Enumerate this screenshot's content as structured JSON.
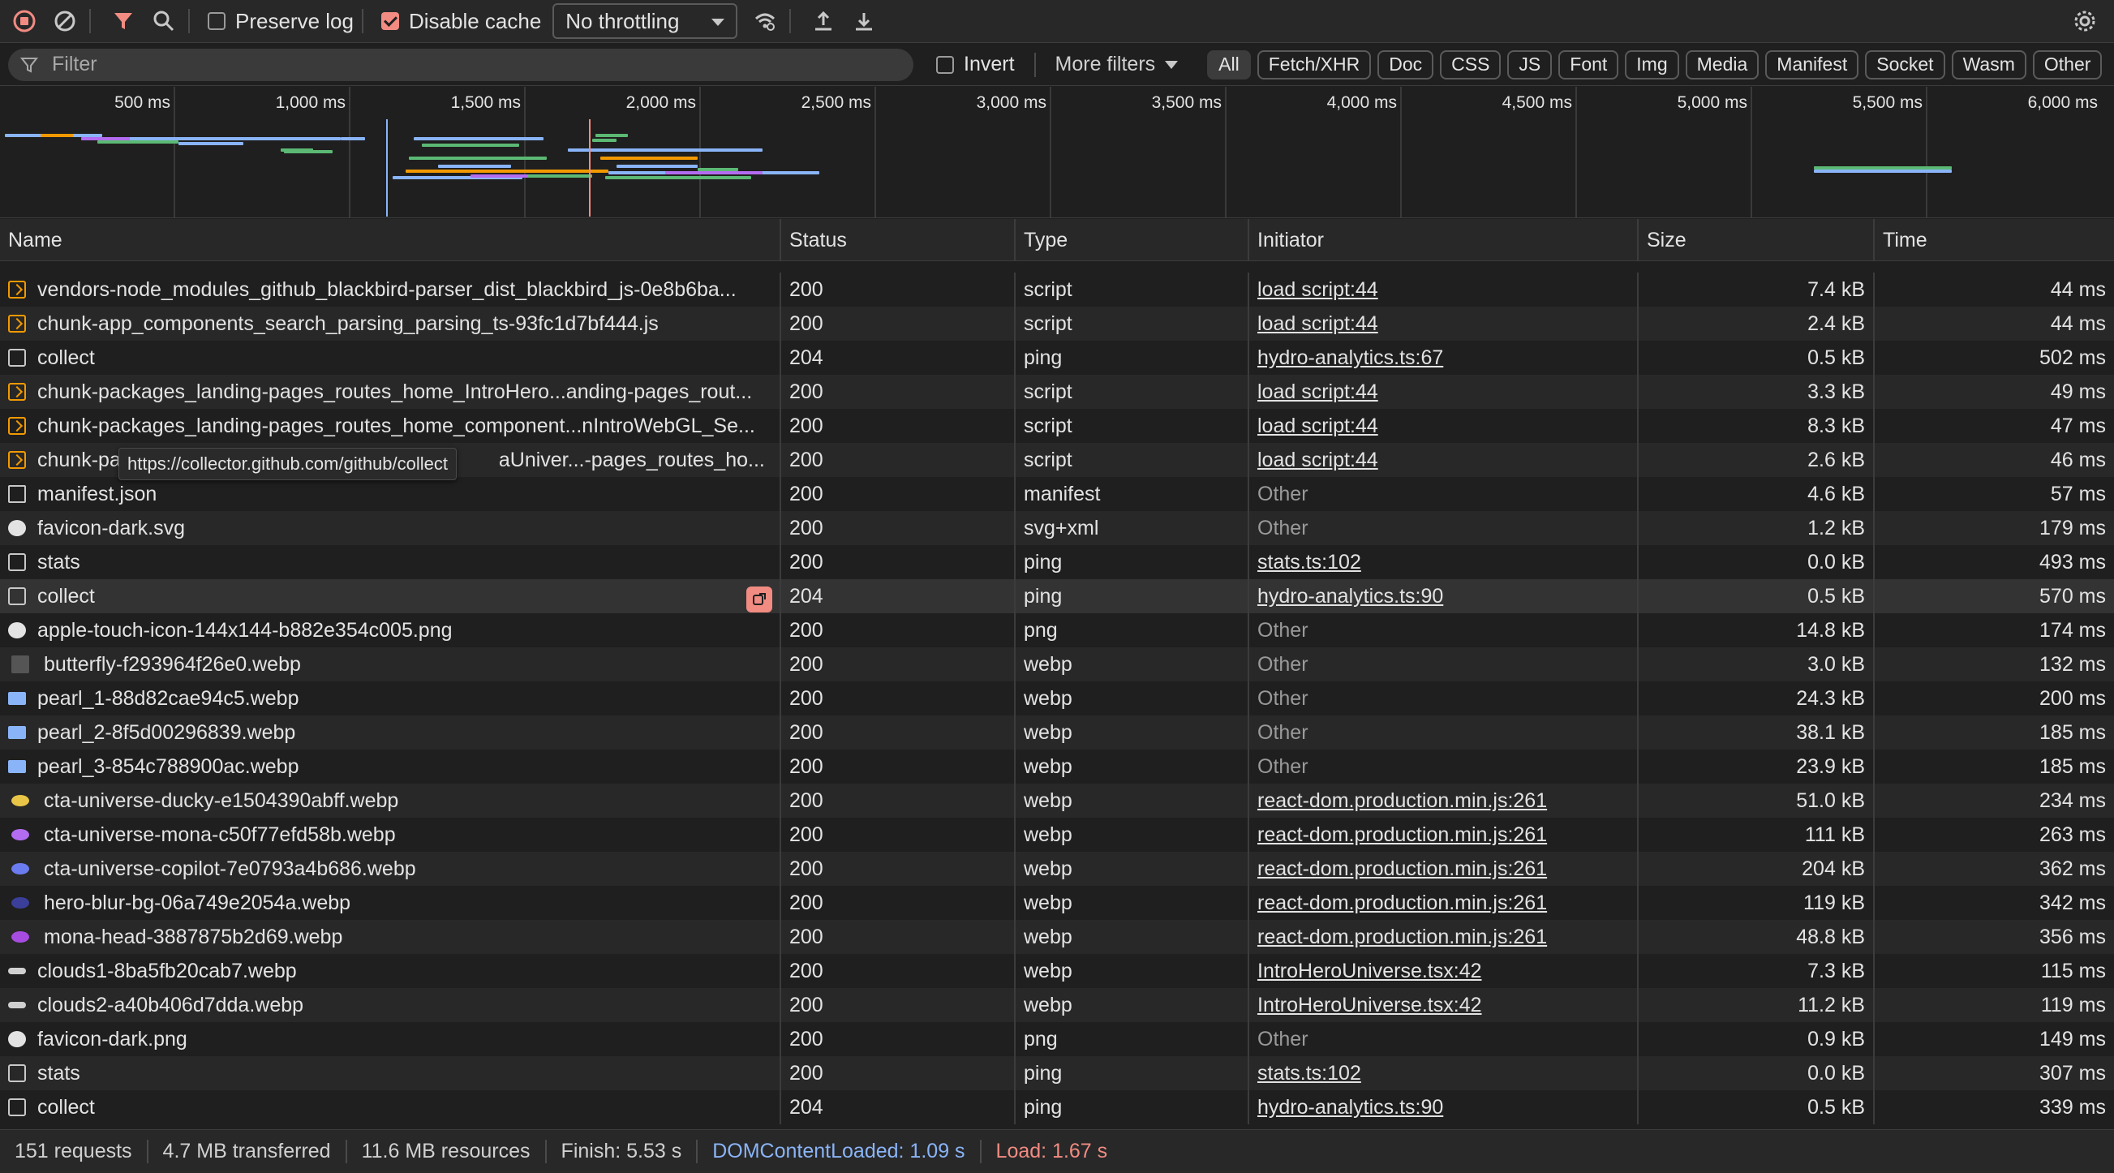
{
  "toolbar": {
    "preserve_log_label": "Preserve log",
    "disable_cache_label": "Disable cache",
    "throttling_value": "No throttling"
  },
  "filterbar": {
    "filter_placeholder": "Filter",
    "invert_label": "Invert",
    "more_filters_label": "More filters",
    "chips": [
      "All",
      "Fetch/XHR",
      "Doc",
      "CSS",
      "JS",
      "Font",
      "Img",
      "Media",
      "Manifest",
      "Socket",
      "Wasm",
      "Other"
    ]
  },
  "overview": {
    "tick_labels": [
      "500 ms",
      "1,000 ms",
      "1,500 ms",
      "2,000 ms",
      "2,500 ms",
      "3,000 ms",
      "3,500 ms",
      "4,000 ms",
      "4,500 ms",
      "5,000 ms",
      "5,500 ms",
      "6,000 ms"
    ]
  },
  "table": {
    "headers": [
      "Name",
      "Status",
      "Type",
      "Initiator",
      "Size",
      "Time"
    ],
    "rows": [
      {
        "name": "vendors-node_modules_github_blackbird-parser_dist_blackbird_js-0e8b6ba...",
        "status": "200",
        "type": "script",
        "initiator": "load script:44",
        "initiator_link": true,
        "size": "7.4 kB",
        "time": "44 ms",
        "icon": "script"
      },
      {
        "name": "chunk-app_components_search_parsing_parsing_ts-93fc1d7bf444.js",
        "status": "200",
        "type": "script",
        "initiator": "load script:44",
        "initiator_link": true,
        "size": "2.4 kB",
        "time": "44 ms",
        "icon": "script"
      },
      {
        "name": "collect",
        "status": "204",
        "type": "ping",
        "initiator": "hydro-analytics.ts:67",
        "initiator_link": true,
        "size": "0.5 kB",
        "time": "502 ms",
        "icon": "ping"
      },
      {
        "name": "chunk-packages_landing-pages_routes_home_IntroHero...anding-pages_rout...",
        "status": "200",
        "type": "script",
        "initiator": "load script:44",
        "initiator_link": true,
        "size": "3.3 kB",
        "time": "49 ms",
        "icon": "script"
      },
      {
        "name": "chunk-packages_landing-pages_routes_home_component...nIntroWebGL_Se...",
        "status": "200",
        "type": "script",
        "initiator": "load script:44",
        "initiator_link": true,
        "size": "8.3 kB",
        "time": "47 ms",
        "icon": "script"
      },
      {
        "name": "chunk-pa",
        "name_suffix": "aUniver...-pages_routes_ho...",
        "status": "200",
        "type": "script",
        "initiator": "load script:44",
        "initiator_link": true,
        "size": "2.6 kB",
        "time": "46 ms",
        "icon": "script"
      },
      {
        "name": "manifest.json",
        "status": "200",
        "type": "manifest",
        "initiator": "Other",
        "initiator_link": false,
        "size": "4.6 kB",
        "time": "57 ms",
        "icon": "doc"
      },
      {
        "name": "favicon-dark.svg",
        "status": "200",
        "type": "svg+xml",
        "initiator": "Other",
        "initiator_link": false,
        "size": "1.2 kB",
        "time": "179 ms",
        "icon": "gh"
      },
      {
        "name": "stats",
        "status": "200",
        "type": "ping",
        "initiator": "stats.ts:102",
        "initiator_link": true,
        "size": "0.0 kB",
        "time": "493 ms",
        "icon": "ping"
      },
      {
        "name": "collect",
        "status": "204",
        "type": "ping",
        "initiator": "hydro-analytics.ts:90",
        "initiator_link": true,
        "size": "0.5 kB",
        "time": "570 ms",
        "icon": "ping"
      },
      {
        "name": "apple-touch-icon-144x144-b882e354c005.png",
        "status": "200",
        "type": "png",
        "initiator": "Other",
        "initiator_link": false,
        "size": "14.8 kB",
        "time": "174 ms",
        "icon": "gh"
      },
      {
        "name": "butterfly-f293964f26e0.webp",
        "status": "200",
        "type": "webp",
        "initiator": "Other",
        "initiator_link": false,
        "size": "3.0 kB",
        "time": "132 ms",
        "icon": "dark"
      },
      {
        "name": "pearl_1-88d82cae94c5.webp",
        "status": "200",
        "type": "webp",
        "initiator": "Other",
        "initiator_link": false,
        "size": "24.3 kB",
        "time": "200 ms",
        "icon": "img"
      },
      {
        "name": "pearl_2-8f5d00296839.webp",
        "status": "200",
        "type": "webp",
        "initiator": "Other",
        "initiator_link": false,
        "size": "38.1 kB",
        "time": "185 ms",
        "icon": "img"
      },
      {
        "name": "pearl_3-854c788900ac.webp",
        "status": "200",
        "type": "webp",
        "initiator": "Other",
        "initiator_link": false,
        "size": "23.9 kB",
        "time": "185 ms",
        "icon": "img"
      },
      {
        "name": "cta-universe-ducky-e1504390abff.webp",
        "status": "200",
        "type": "webp",
        "initiator": "react-dom.production.min.js:261",
        "initiator_link": true,
        "size": "51.0 kB",
        "time": "234 ms",
        "icon": "dot",
        "dot_color": "#e8c547"
      },
      {
        "name": "cta-universe-mona-c50f77efd58b.webp",
        "status": "200",
        "type": "webp",
        "initiator": "react-dom.production.min.js:261",
        "initiator_link": true,
        "size": "111 kB",
        "time": "263 ms",
        "icon": "dot",
        "dot_color": "#b36cf0"
      },
      {
        "name": "cta-universe-copilot-7e0793a4b686.webp",
        "status": "200",
        "type": "webp",
        "initiator": "react-dom.production.min.js:261",
        "initiator_link": true,
        "size": "204 kB",
        "time": "362 ms",
        "icon": "dot",
        "dot_color": "#6b7cf0"
      },
      {
        "name": "hero-blur-bg-06a749e2054a.webp",
        "status": "200",
        "type": "webp",
        "initiator": "react-dom.production.min.js:261",
        "initiator_link": true,
        "size": "119 kB",
        "time": "342 ms",
        "icon": "dot",
        "dot_color": "#3b3f9a"
      },
      {
        "name": "mona-head-3887875b2d69.webp",
        "status": "200",
        "type": "webp",
        "initiator": "react-dom.production.min.js:261",
        "initiator_link": true,
        "size": "48.8 kB",
        "time": "356 ms",
        "icon": "dot",
        "dot_color": "#a74ce0"
      },
      {
        "name": "clouds1-8ba5fb20cab7.webp",
        "status": "200",
        "type": "webp",
        "initiator": "IntroHeroUniverse.tsx:42",
        "initiator_link": true,
        "size": "7.3 kB",
        "time": "115 ms",
        "icon": "cloud"
      },
      {
        "name": "clouds2-a40b406d7dda.webp",
        "status": "200",
        "type": "webp",
        "initiator": "IntroHeroUniverse.tsx:42",
        "initiator_link": true,
        "size": "11.2 kB",
        "time": "119 ms",
        "icon": "cloud"
      },
      {
        "name": "favicon-dark.png",
        "status": "200",
        "type": "png",
        "initiator": "Other",
        "initiator_link": false,
        "size": "0.9 kB",
        "time": "149 ms",
        "icon": "gh"
      },
      {
        "name": "stats",
        "status": "200",
        "type": "ping",
        "initiator": "stats.ts:102",
        "initiator_link": true,
        "size": "0.0 kB",
        "time": "307 ms",
        "icon": "ping"
      },
      {
        "name": "collect",
        "status": "204",
        "type": "ping",
        "initiator": "hydro-analytics.ts:90",
        "initiator_link": true,
        "size": "0.5 kB",
        "time": "339 ms",
        "icon": "ping"
      }
    ]
  },
  "tooltip": {
    "text": "https://collector.github.com/github/collect"
  },
  "statusbar": {
    "requests": "151 requests",
    "transferred": "4.7 MB transferred",
    "resources": "11.6 MB resources",
    "finish": "Finish: 5.53 s",
    "dom_content_loaded": "DOMContentLoaded: 1.09 s",
    "load": "Load: 1.67 s"
  },
  "colors": {
    "accent_red": "#f28b82",
    "accent_blue": "#8ab4f8",
    "script_orange": "#f29900"
  }
}
